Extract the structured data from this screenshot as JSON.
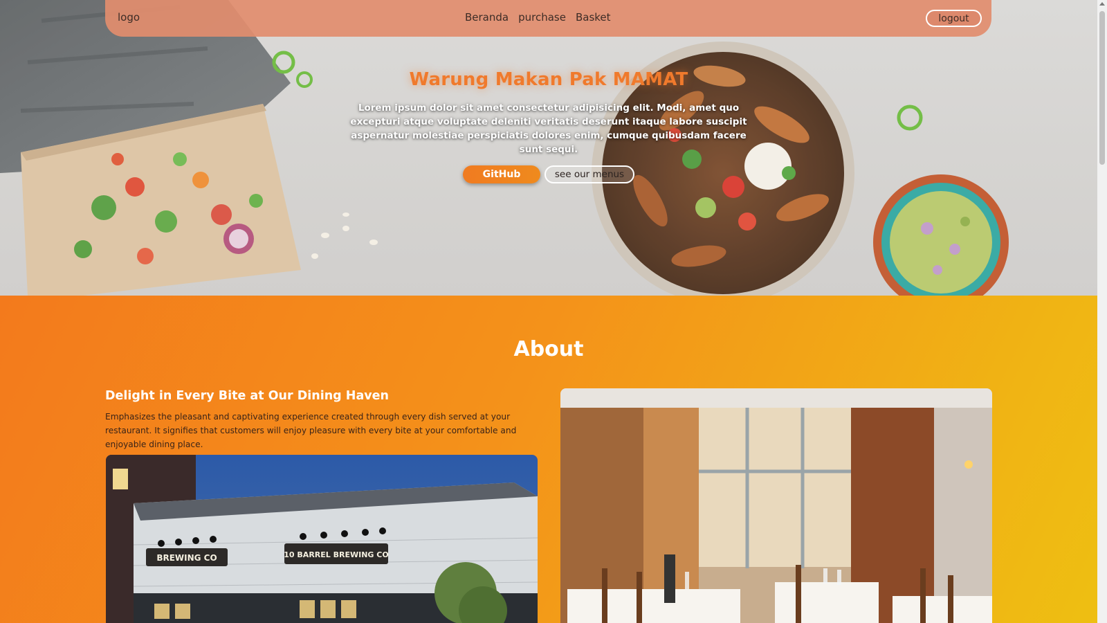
{
  "navbar": {
    "logo": "logo",
    "links": [
      "Beranda",
      "purchase",
      "Basket"
    ],
    "logout_label": "logout"
  },
  "hero": {
    "title": "Warung Makan Pak MAMAT",
    "description": "Lorem ipsum dolor sit amet consectetur adipisicing elit. Modi, amet quo excepturi atque voluptate deleniti veritatis deserunt itaque labore suscipit aspernatur molestiae perspiciatis dolores enim, cumque quibusdam facere sunt sequi.",
    "github_label": "GitHub",
    "menus_label": "see our menus"
  },
  "about": {
    "title": "About",
    "subtitle": "Delight in Every Bite at Our Dining Haven",
    "text": "Emphasizes the pleasant and captivating experience created through every dish served at your restaurant. It signifies that customers will enjoy pleasure with every bite at your comfortable and enjoyable dining place.",
    "storefront_sign_main": "10 BARREL BREWING CO",
    "storefront_sign_side": "BREWING CO"
  },
  "colors": {
    "accent": "#f07a2c",
    "navbar": "#e28d6e",
    "about_gradient_start": "#f37a1c",
    "about_gradient_end": "#eebf12"
  }
}
